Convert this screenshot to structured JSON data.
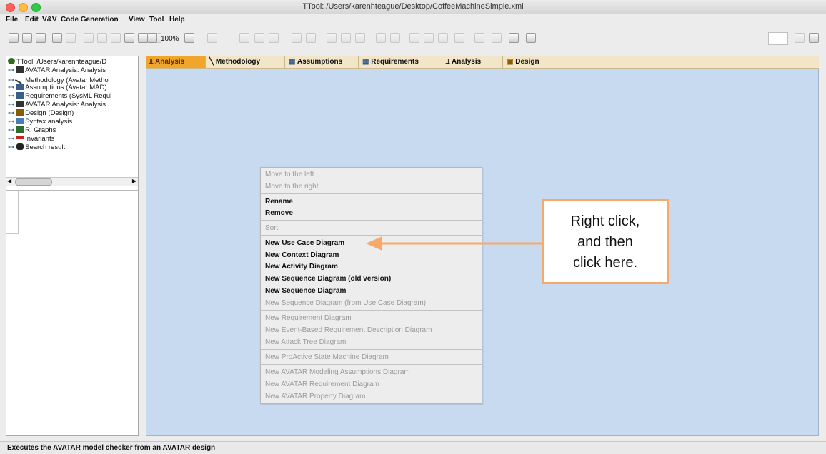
{
  "window": {
    "title": "TTool: /Users/karenhteague/Desktop/CoffeeMachineSimple.xml"
  },
  "menubar": [
    "File",
    "Edit",
    "V&V",
    "Code Generation",
    "View",
    "Tool",
    "Help"
  ],
  "toolbar": {
    "zoom_label": "100%"
  },
  "tree": {
    "items": [
      {
        "label": "TTool: /Users/karenhteague/D",
        "icon": "ttool-root-icon",
        "color": "#2e6b1f"
      },
      {
        "label": "AVATAR Analysis: Analysis",
        "icon": "analysis-icon",
        "color": "#333333"
      },
      {
        "label": "Methodology (Avatar Metho",
        "icon": "methodology-icon",
        "color": "#333333"
      },
      {
        "label": "Assumptions (Avatar MAD)",
        "icon": "assumptions-icon",
        "color": "#3a5e8c"
      },
      {
        "label": "Requirements (SysML Requi",
        "icon": "requirements-icon",
        "color": "#3a5e8c"
      },
      {
        "label": "AVATAR Analysis: Analysis",
        "icon": "analysis-icon",
        "color": "#333333"
      },
      {
        "label": "Design (Design)",
        "icon": "design-icon",
        "color": "#8a5a00"
      },
      {
        "label": "Syntax analysis",
        "icon": "syntax-icon",
        "color": "#4b7bb3"
      },
      {
        "label": "R. Graphs",
        "icon": "graph-icon",
        "color": "#2f6d2f"
      },
      {
        "label": "Invariants",
        "icon": "invariants-icon",
        "color": "#cc2222"
      },
      {
        "label": "Search result",
        "icon": "binoculars-icon",
        "color": "#222222"
      }
    ]
  },
  "tabs": [
    {
      "label": "Analysis",
      "icon": "analysis-icon",
      "active": true
    },
    {
      "label": "Methodology",
      "icon": "methodology-icon",
      "active": false
    },
    {
      "label": "Assumptions",
      "icon": "assumptions-icon",
      "active": false
    },
    {
      "label": "Requirements",
      "icon": "requirements-icon",
      "active": false
    },
    {
      "label": "Analysis",
      "icon": "analysis-icon",
      "active": false
    },
    {
      "label": "Design",
      "icon": "design-icon",
      "active": false
    }
  ],
  "context_menu": {
    "items": [
      {
        "label": "Move to the left",
        "enabled": false
      },
      {
        "label": "Move to the right",
        "enabled": false
      },
      {
        "label": "Rename",
        "enabled": true
      },
      {
        "label": "Remove",
        "enabled": true
      },
      {
        "label": "Sort",
        "enabled": false
      },
      {
        "label": "New Use Case Diagram",
        "enabled": true
      },
      {
        "label": "New Context Diagram",
        "enabled": true
      },
      {
        "label": "New Activity Diagram",
        "enabled": true
      },
      {
        "label": "New Sequence Diagram (old version)",
        "enabled": true
      },
      {
        "label": "New Sequence Diagram",
        "enabled": true
      },
      {
        "label": "New Sequence Diagram (from Use Case Diagram)",
        "enabled": false
      },
      {
        "label": "New Requirement Diagram",
        "enabled": false
      },
      {
        "label": "New Event-Based Requirement Description Diagram",
        "enabled": false
      },
      {
        "label": "New Attack Tree Diagram",
        "enabled": false
      },
      {
        "label": "New ProActive State Machine Diagram",
        "enabled": false
      },
      {
        "label": "New AVATAR Modeling Assumptions Diagram",
        "enabled": false
      },
      {
        "label": "New AVATAR Requirement Diagram",
        "enabled": false
      },
      {
        "label": "New AVATAR Property Diagram",
        "enabled": false
      }
    ]
  },
  "annotation": {
    "lines": [
      "Right click,",
      "and then",
      "click here."
    ],
    "color": "#f7a86a"
  },
  "statusbar": {
    "text": "Executes the AVATAR model checker from an AVATAR design"
  },
  "colors": {
    "canvas": "#c7daef",
    "tab_active": "#f0a62a",
    "tab_bar": "#f3e6c8"
  }
}
